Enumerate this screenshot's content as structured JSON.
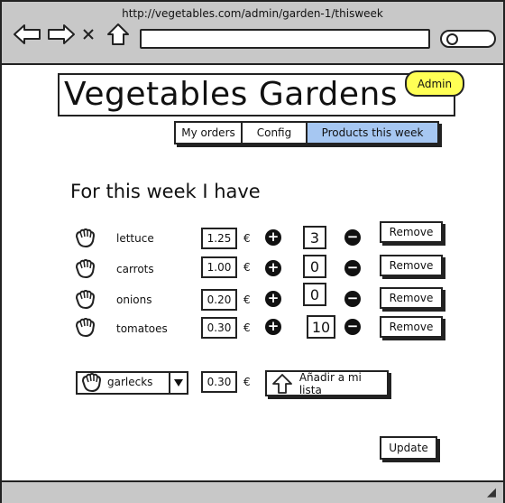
{
  "browser": {
    "url": "http://vegetables.com/admin/garden-1/thisweek"
  },
  "header": {
    "title": "Vegetables Gardens",
    "badge": "Admin"
  },
  "tabs": [
    {
      "label": "My orders",
      "active": false
    },
    {
      "label": "Config",
      "active": false
    },
    {
      "label": "Products this week",
      "active": true
    }
  ],
  "main": {
    "section_title": "For this week I have",
    "currency": "€",
    "products": [
      {
        "name": "lettuce",
        "price": "1.25",
        "quantity": "3",
        "remove_label": "Remove"
      },
      {
        "name": "carrots",
        "price": "1.00",
        "quantity": "0",
        "remove_label": "Remove"
      },
      {
        "name": "onions",
        "price": "0.20",
        "quantity": "0",
        "remove_label": "Remove"
      },
      {
        "name": "tomatoes",
        "price": "0.30",
        "quantity": "10",
        "remove_label": "Remove"
      }
    ],
    "add_row": {
      "selected": "garlecks",
      "price": "0.30",
      "add_label": "Añadir a mi lista"
    },
    "update_label": "Update"
  },
  "colors": {
    "chrome": "#c8c8c8",
    "badge": "#ffff55",
    "active_tab": "#a6c7f2"
  }
}
